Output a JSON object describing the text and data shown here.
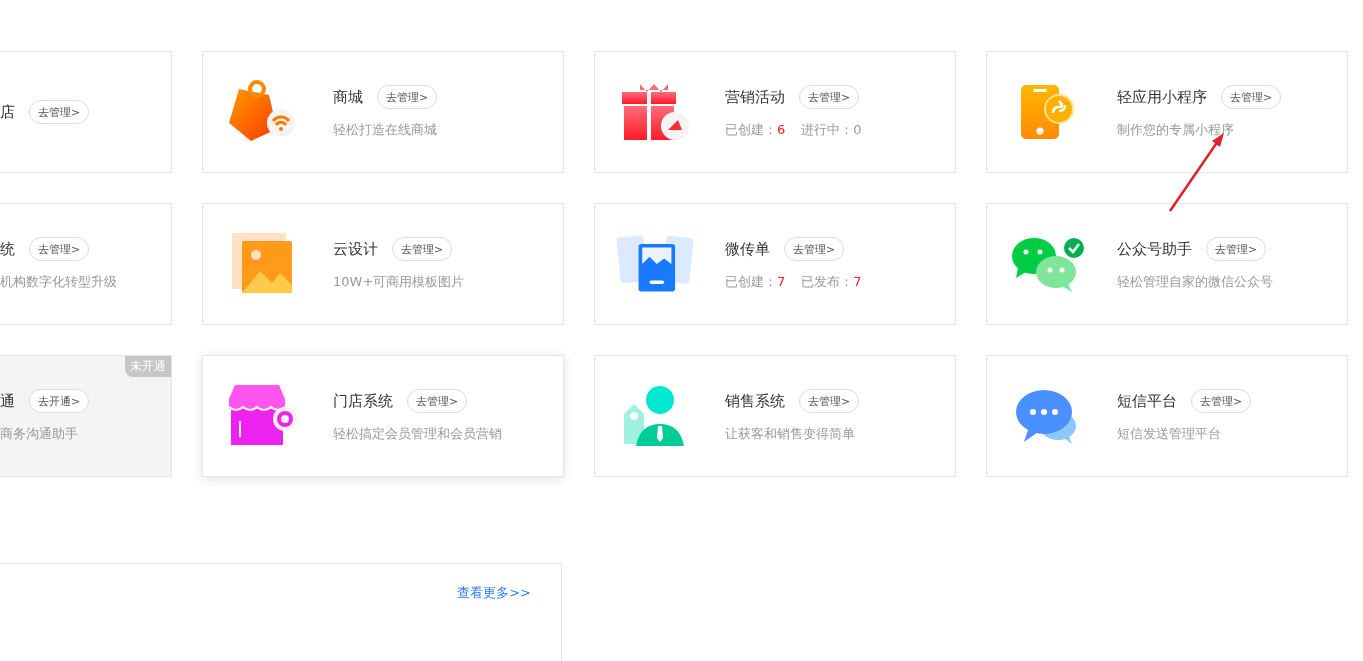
{
  "cards": [
    {
      "title": "店",
      "button": "去管理>",
      "raised": false
    },
    {
      "title": "商城",
      "button": "去管理>",
      "description": "轻松打造在线商城",
      "raised": false
    },
    {
      "title": "营销活动",
      "button": "去管理>",
      "stats": [
        {
          "label": "已创建：",
          "value": "6",
          "highlight": true
        },
        {
          "label": "进行中：",
          "value": "0",
          "highlight": false
        }
      ],
      "raised": false
    },
    {
      "title": "轻应用小程序",
      "button": "去管理>",
      "description": "制作您的专属小程序",
      "raised": false
    },
    {
      "title": "统",
      "button": "去管理>",
      "description": "机构数字化转型升级",
      "raised": false
    },
    {
      "title": "云设计",
      "button": "去管理>",
      "description": "10W+可商用模板图片",
      "raised": false
    },
    {
      "title": "微传单",
      "button": "去管理>",
      "stats": [
        {
          "label": "已创建：",
          "value": "7",
          "highlight": true
        },
        {
          "label": "已发布：",
          "value": "7",
          "highlight": true
        }
      ],
      "raised": false
    },
    {
      "title": "公众号助手",
      "button": "去管理>",
      "description": "轻松管理自家的微信公众号",
      "raised": false
    },
    {
      "title": "通",
      "button": "去开通>",
      "description": "商务沟通助手",
      "badge": "未开通",
      "raised": false
    },
    {
      "title": "门店系统",
      "button": "去管理>",
      "description": "轻松搞定会员管理和会员营销",
      "raised": true
    },
    {
      "title": "销售系统",
      "button": "去管理>",
      "description": "让获客和销售变得简单",
      "raised": false
    },
    {
      "title": "短信平台",
      "button": "去管理>",
      "description": "短信发送管理平台",
      "raised": false
    }
  ],
  "panel": {
    "link": "查看更多>>"
  }
}
